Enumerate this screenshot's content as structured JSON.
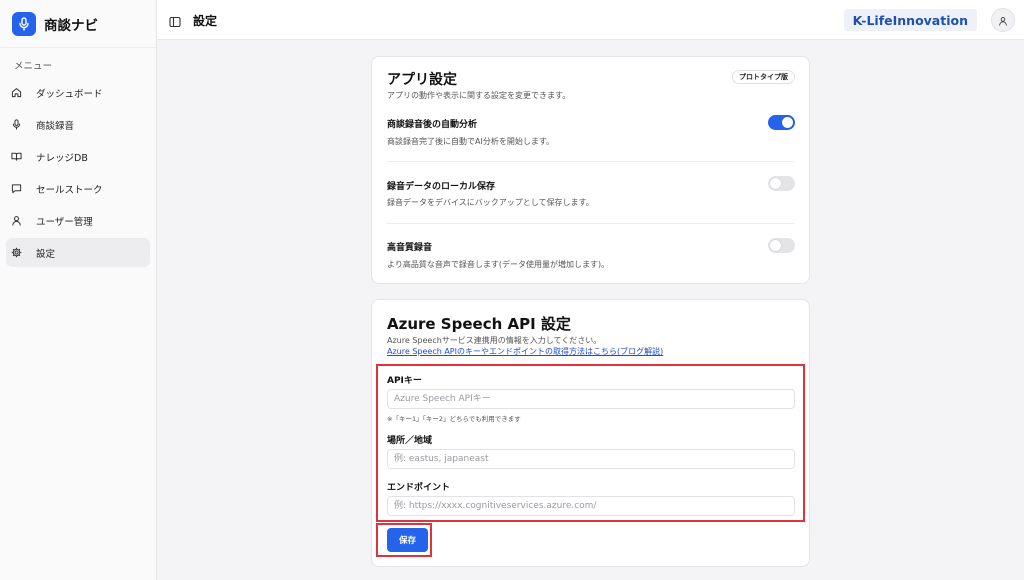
{
  "app": {
    "name": "商談ナビ"
  },
  "sidebar": {
    "heading": "メニュー",
    "items": [
      {
        "label": "ダッシュボード",
        "icon": "home-icon"
      },
      {
        "label": "商談録音",
        "icon": "microphone-icon"
      },
      {
        "label": "ナレッジDB",
        "icon": "book-icon"
      },
      {
        "label": "セールストーク",
        "icon": "chat-icon"
      },
      {
        "label": "ユーザー管理",
        "icon": "user-icon"
      },
      {
        "label": "設定",
        "icon": "gear-icon",
        "active": true
      }
    ]
  },
  "header": {
    "title": "設定",
    "org": "K-LifeInnovation"
  },
  "app_settings": {
    "title": "アプリ設定",
    "badge": "プロトタイプ版",
    "description": "アプリの動作や表示に関する設定を変更できます。",
    "settings": [
      {
        "title": "商談録音後の自動分析",
        "description": "商談録音完了後に自動でAI分析を開始します。",
        "enabled": true
      },
      {
        "title": "録音データのローカル保存",
        "description": "録音データをデバイスにバックアップとして保存します。",
        "enabled": false
      },
      {
        "title": "高音質録音",
        "description": "より高品質な音声で録音します(データ使用量が増加します)。",
        "enabled": false
      }
    ]
  },
  "azure": {
    "title": "Azure Speech API 設定",
    "description": "Azure Speechサービス連携用の情報を入力してください。",
    "link": "Azure Speech APIのキーやエンドポイントの取得方法はこちら(ブログ解説)",
    "api_key": {
      "label": "APIキー",
      "placeholder": "Azure Speech APIキー",
      "value": "",
      "note": "※「キー1」「キー2」どちらでも利用できます"
    },
    "region": {
      "label": "場所／地域",
      "placeholder": "例: eastus, japaneast",
      "value": ""
    },
    "endpoint": {
      "label": "エンドポイント",
      "placeholder": "例: https://xxxx.cognitiveservices.azure.com/",
      "value": ""
    },
    "save_label": "保存"
  },
  "colors": {
    "accent": "#2563eb",
    "highlight": "#e0333d",
    "org_text": "#1f4fb0"
  }
}
